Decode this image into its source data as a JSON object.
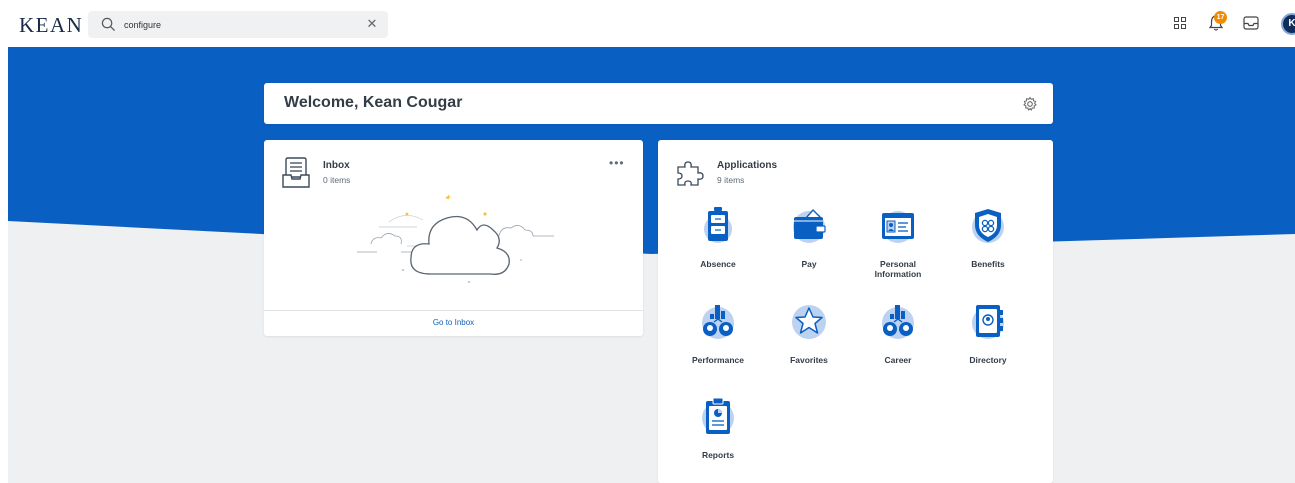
{
  "header": {
    "logo_text": "KEAN",
    "search_value": "configure",
    "notification_count": "17",
    "avatar_initial": "K"
  },
  "welcome": {
    "title": "Welcome, Kean Cougar"
  },
  "inbox": {
    "title": "Inbox",
    "count": "0 items",
    "footer_link": "Go to Inbox"
  },
  "applications": {
    "title": "Applications",
    "count": "9 items",
    "items": [
      {
        "label": "Absence",
        "icon": "luggage-icon"
      },
      {
        "label": "Pay",
        "icon": "wallet-icon"
      },
      {
        "label": "Personal Information",
        "icon": "id-card-icon"
      },
      {
        "label": "Benefits",
        "icon": "shield-icon"
      },
      {
        "label": "Performance",
        "icon": "performance-icon"
      },
      {
        "label": "Favorites",
        "icon": "star-icon"
      },
      {
        "label": "Career",
        "icon": "career-icon"
      },
      {
        "label": "Directory",
        "icon": "directory-icon"
      },
      {
        "label": "Reports",
        "icon": "clipboard-icon"
      }
    ]
  },
  "colors": {
    "brand_blue": "#0a5fc2",
    "page_gray": "#eef0f2",
    "accent_orange": "#f38b00"
  }
}
